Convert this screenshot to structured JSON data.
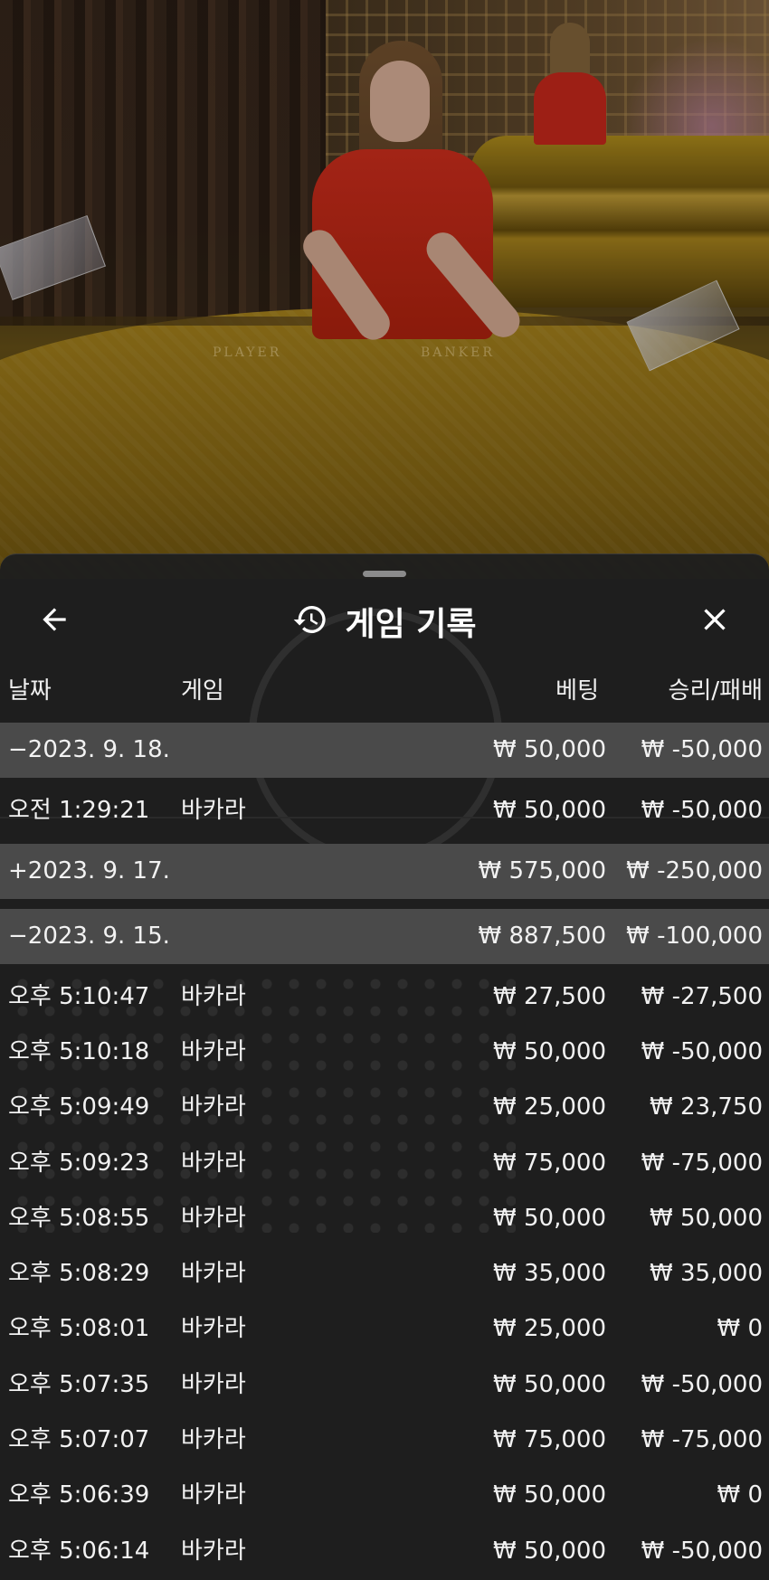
{
  "video": {
    "table_label_player": "PLAYER",
    "table_label_banker": "BANKER"
  },
  "header": {
    "title": "게임 기록",
    "icons": {
      "back": "arrow-left-icon",
      "history": "history-icon",
      "close": "close-icon"
    }
  },
  "columns": {
    "date": "날짜",
    "game": "게임",
    "bet": "베팅",
    "result": "승리/패배"
  },
  "rows": [
    {
      "type": "group",
      "date": "−2023. 9. 18.",
      "game": "",
      "bet": "₩ 50,000",
      "result": "₩ -50,000"
    },
    {
      "type": "item",
      "date": "오전 1:29:21",
      "game": "바카라",
      "bet": "₩ 50,000",
      "result": "₩ -50,000"
    },
    {
      "type": "group",
      "date": "+2023. 9. 17.",
      "game": "",
      "bet": "₩ 575,000",
      "result": "₩ -250,000"
    },
    {
      "type": "group",
      "date": "−2023. 9. 15.",
      "game": "",
      "bet": "₩ 887,500",
      "result": "₩ -100,000"
    },
    {
      "type": "item",
      "date": "오후 5:10:47",
      "game": "바카라",
      "bet": "₩ 27,500",
      "result": "₩ -27,500"
    },
    {
      "type": "item",
      "date": "오후 5:10:18",
      "game": "바카라",
      "bet": "₩ 50,000",
      "result": "₩ -50,000"
    },
    {
      "type": "item",
      "date": "오후 5:09:49",
      "game": "바카라",
      "bet": "₩ 25,000",
      "result": "₩ 23,750"
    },
    {
      "type": "item",
      "date": "오후 5:09:23",
      "game": "바카라",
      "bet": "₩ 75,000",
      "result": "₩ -75,000"
    },
    {
      "type": "item",
      "date": "오후 5:08:55",
      "game": "바카라",
      "bet": "₩ 50,000",
      "result": "₩ 50,000"
    },
    {
      "type": "item",
      "date": "오후 5:08:29",
      "game": "바카라",
      "bet": "₩ 35,000",
      "result": "₩ 35,000"
    },
    {
      "type": "item",
      "date": "오후 5:08:01",
      "game": "바카라",
      "bet": "₩ 25,000",
      "result": "₩ 0"
    },
    {
      "type": "item",
      "date": "오후 5:07:35",
      "game": "바카라",
      "bet": "₩ 50,000",
      "result": "₩ -50,000"
    },
    {
      "type": "item",
      "date": "오후 5:07:07",
      "game": "바카라",
      "bet": "₩ 75,000",
      "result": "₩ -75,000"
    },
    {
      "type": "item",
      "date": "오후 5:06:39",
      "game": "바카라",
      "bet": "₩ 50,000",
      "result": "₩ 0"
    },
    {
      "type": "item",
      "date": "오후 5:06:14",
      "game": "바카라",
      "bet": "₩ 50,000",
      "result": "₩ -50,000"
    }
  ]
}
